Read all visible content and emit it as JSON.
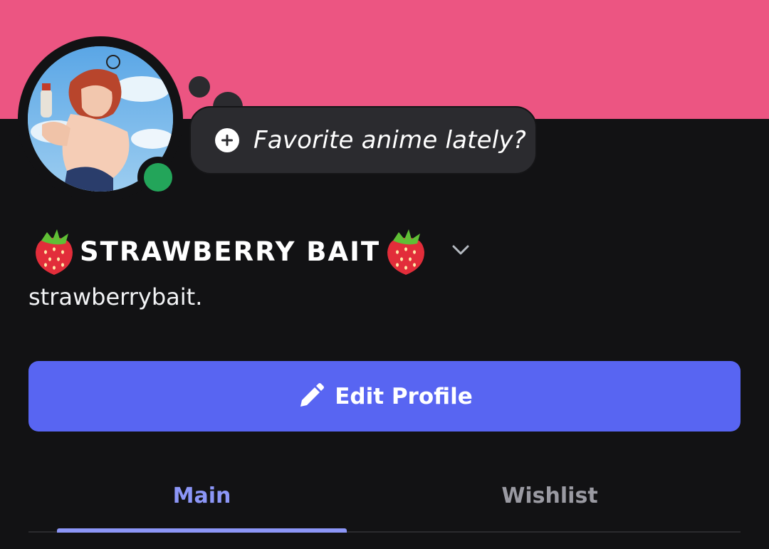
{
  "profile": {
    "banner_color": "#ec5582",
    "avatar_alt": "avatar",
    "online_status": "online",
    "status_prompt": "Favorite anime lately?",
    "display_name": "STRAWBERRY BAIT",
    "username": "strawberrybait.",
    "name_emoji": "strawberry"
  },
  "actions": {
    "edit_profile_label": "Edit Profile"
  },
  "tabs": [
    {
      "label": "Main",
      "active": true
    },
    {
      "label": "Wishlist",
      "active": false
    }
  ],
  "colors": {
    "accent": "#5865f2",
    "active_tab": "#8c96f7",
    "status_online": "#23a55a",
    "background": "#121214"
  }
}
